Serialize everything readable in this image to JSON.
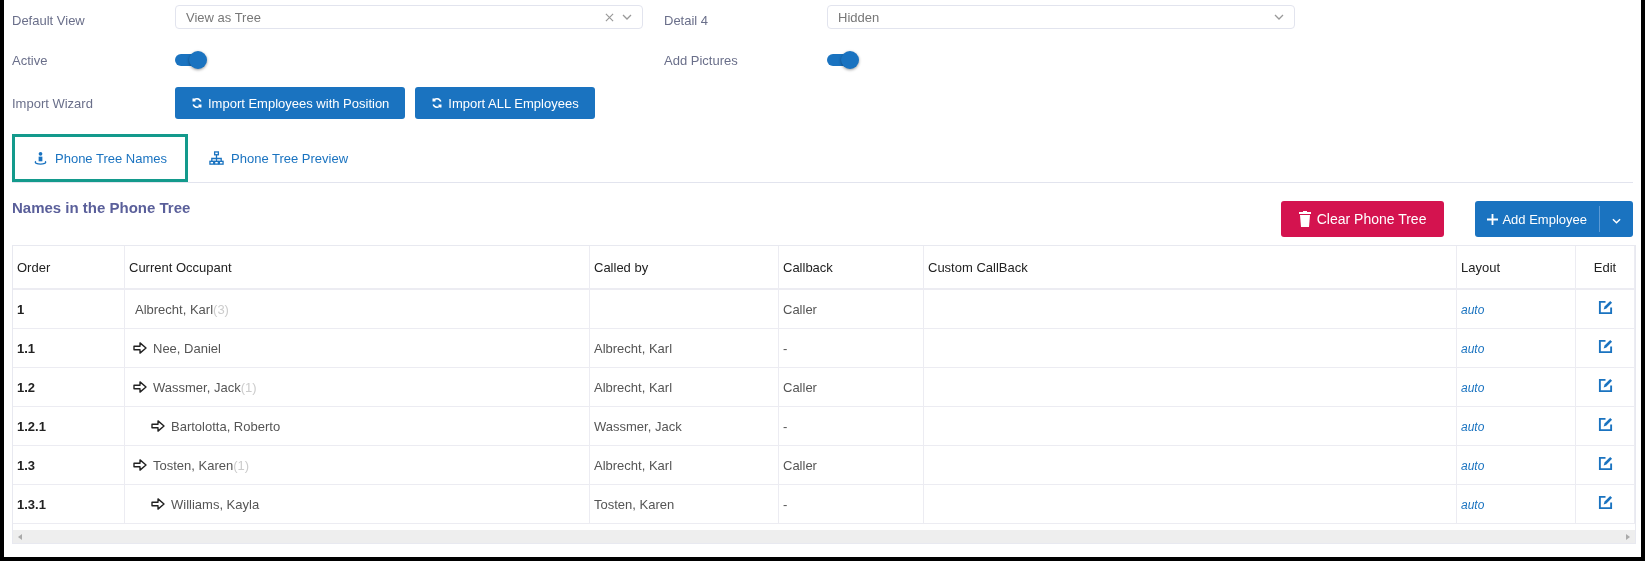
{
  "settings": [
    {
      "kind": "select",
      "label": "Default View",
      "value": "View as Tree",
      "clearable": true
    },
    {
      "kind": "select",
      "label": "Detail 4",
      "value": "Hidden",
      "clearable": false
    },
    {
      "kind": "toggle",
      "label": "Active",
      "on": true
    },
    {
      "kind": "toggle",
      "label": "Add Pictures",
      "on": true
    }
  ],
  "import_wizard": {
    "label": "Import Wizard",
    "buttons": [
      "Import Employees with Position",
      "Import ALL Employees"
    ]
  },
  "tabs": [
    {
      "label": "Phone Tree Names",
      "selected": true
    },
    {
      "label": "Phone Tree Preview",
      "selected": false
    }
  ],
  "section_title": "Names in the Phone Tree",
  "clear_button": "Clear Phone Tree",
  "add_button": "Add Employee",
  "table": {
    "columns": [
      "Order",
      "Current Occupant",
      "Called by",
      "Callback",
      "Custom CallBack",
      "Layout",
      "Edit"
    ],
    "rows": [
      {
        "order": "1",
        "occupant": "Albrecht, Karl",
        "count": "(3)",
        "callback": "Caller",
        "layout": "auto",
        "children": [
          {
            "order": "1.1",
            "occupant": "Nee, Daniel",
            "called_by": "Albrecht, Karl",
            "callback": "-",
            "layout": "auto"
          },
          {
            "order": "1.2",
            "occupant": "Wassmer, Jack",
            "count": "(1)",
            "called_by": "Albrecht, Karl",
            "callback": "Caller",
            "layout": "auto",
            "children": [
              {
                "order": "1.2.1",
                "occupant": "Bartolotta, Roberto",
                "called_by": "Wassmer, Jack",
                "callback": "-",
                "layout": "auto"
              }
            ]
          },
          {
            "order": "1.3",
            "occupant": "Tosten, Karen",
            "count": "(1)",
            "called_by": "Albrecht, Karl",
            "callback": "Caller",
            "layout": "auto",
            "children": [
              {
                "order": "1.3.1",
                "occupant": "Williams, Kayla",
                "called_by": "Tosten, Karen",
                "callback": "-",
                "layout": "auto"
              }
            ]
          }
        ]
      }
    ]
  }
}
